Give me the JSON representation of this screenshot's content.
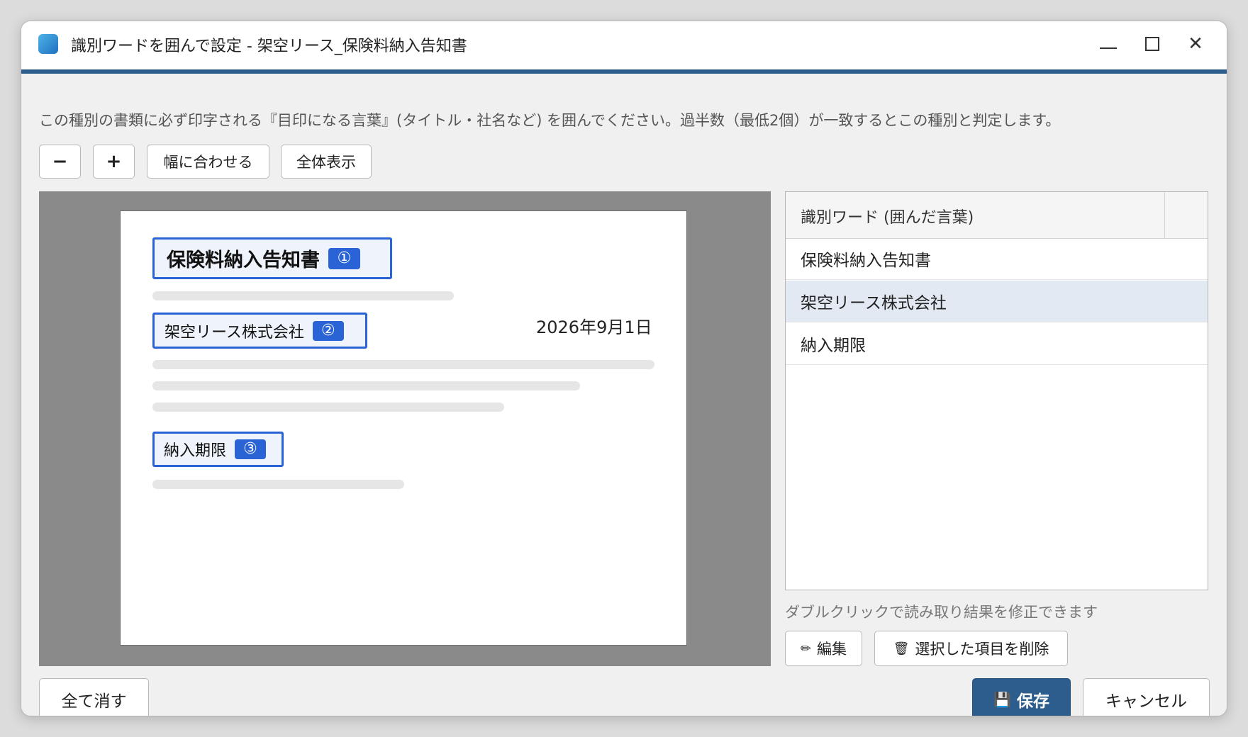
{
  "window": {
    "title": "識別ワードを囲んで設定 - 架空リース_保険料納入告知書",
    "accent_color": "#2c5d8c"
  },
  "instruction": "この種別の書類に必ず印字される『目印になる言葉』(タイトル・社名など) を囲んでください。過半数（最低2個）が一致するとこの種別と判定します。",
  "toolbar": {
    "zoom_out": "−",
    "zoom_in": "+",
    "fit_width": "幅に合わせる",
    "fit_all": "全体表示"
  },
  "document": {
    "boxes": [
      {
        "text": "保険料納入告知書",
        "badge": "①"
      },
      {
        "text": "架空リース株式会社",
        "badge": "②"
      },
      {
        "text": "納入期限",
        "badge": "③"
      }
    ],
    "date": "2026年9月1日",
    "box_color": "#2a63d6"
  },
  "word_list": {
    "header": "識別ワード (囲んだ言葉)",
    "items": [
      "保険料納入告知書",
      "架空リース株式会社",
      "納入期限"
    ],
    "selected_index": 1
  },
  "hint": "ダブルクリックで読み取り結果を修正できます",
  "actions": {
    "edit_icon": "✏",
    "edit": "編集",
    "delete_icon": "🗑",
    "delete": "選択した項目を削除",
    "clear_all": "全て消す",
    "save_icon": "💾",
    "save": "保存",
    "cancel": "キャンセル"
  }
}
